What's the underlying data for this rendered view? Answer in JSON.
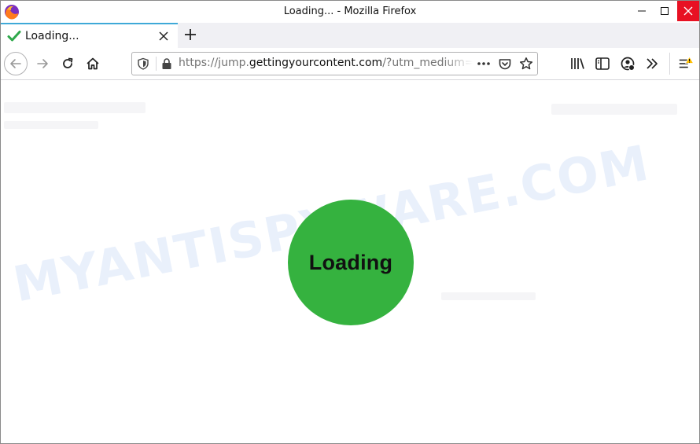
{
  "window": {
    "title": "Loading... - Mozilla Firefox",
    "controls": {
      "minimize": "minimize-icon",
      "maximize": "maximize-icon",
      "close": "close-icon"
    },
    "close_color": "#e81123"
  },
  "tabs": [
    {
      "title": "Loading...",
      "icon": "checkmark-icon",
      "active": true
    }
  ],
  "navbar": {
    "url_prefix": "https://jump.",
    "url_host": "gettingyourcontent.com",
    "url_path": "/?utm_medium=",
    "icons": [
      "back-arrow-icon",
      "forward-arrow-icon",
      "reload-icon",
      "home-icon",
      "shield-icon",
      "lock-icon",
      "more-dots-icon",
      "pocket-icon",
      "star-icon",
      "library-icon",
      "sidebar-icon",
      "account-icon",
      "overflow-chevron-icon",
      "menu-hamburger-icon"
    ],
    "menu_alert_color": "#ffbf00"
  },
  "content": {
    "loader_text": "Loading",
    "loader_color": "#35b23f",
    "watermark": "MYANTISPYWARE.COM"
  },
  "colors": {
    "tab_accent": "#3fa9d8",
    "checkmark": "#2ea84b"
  }
}
